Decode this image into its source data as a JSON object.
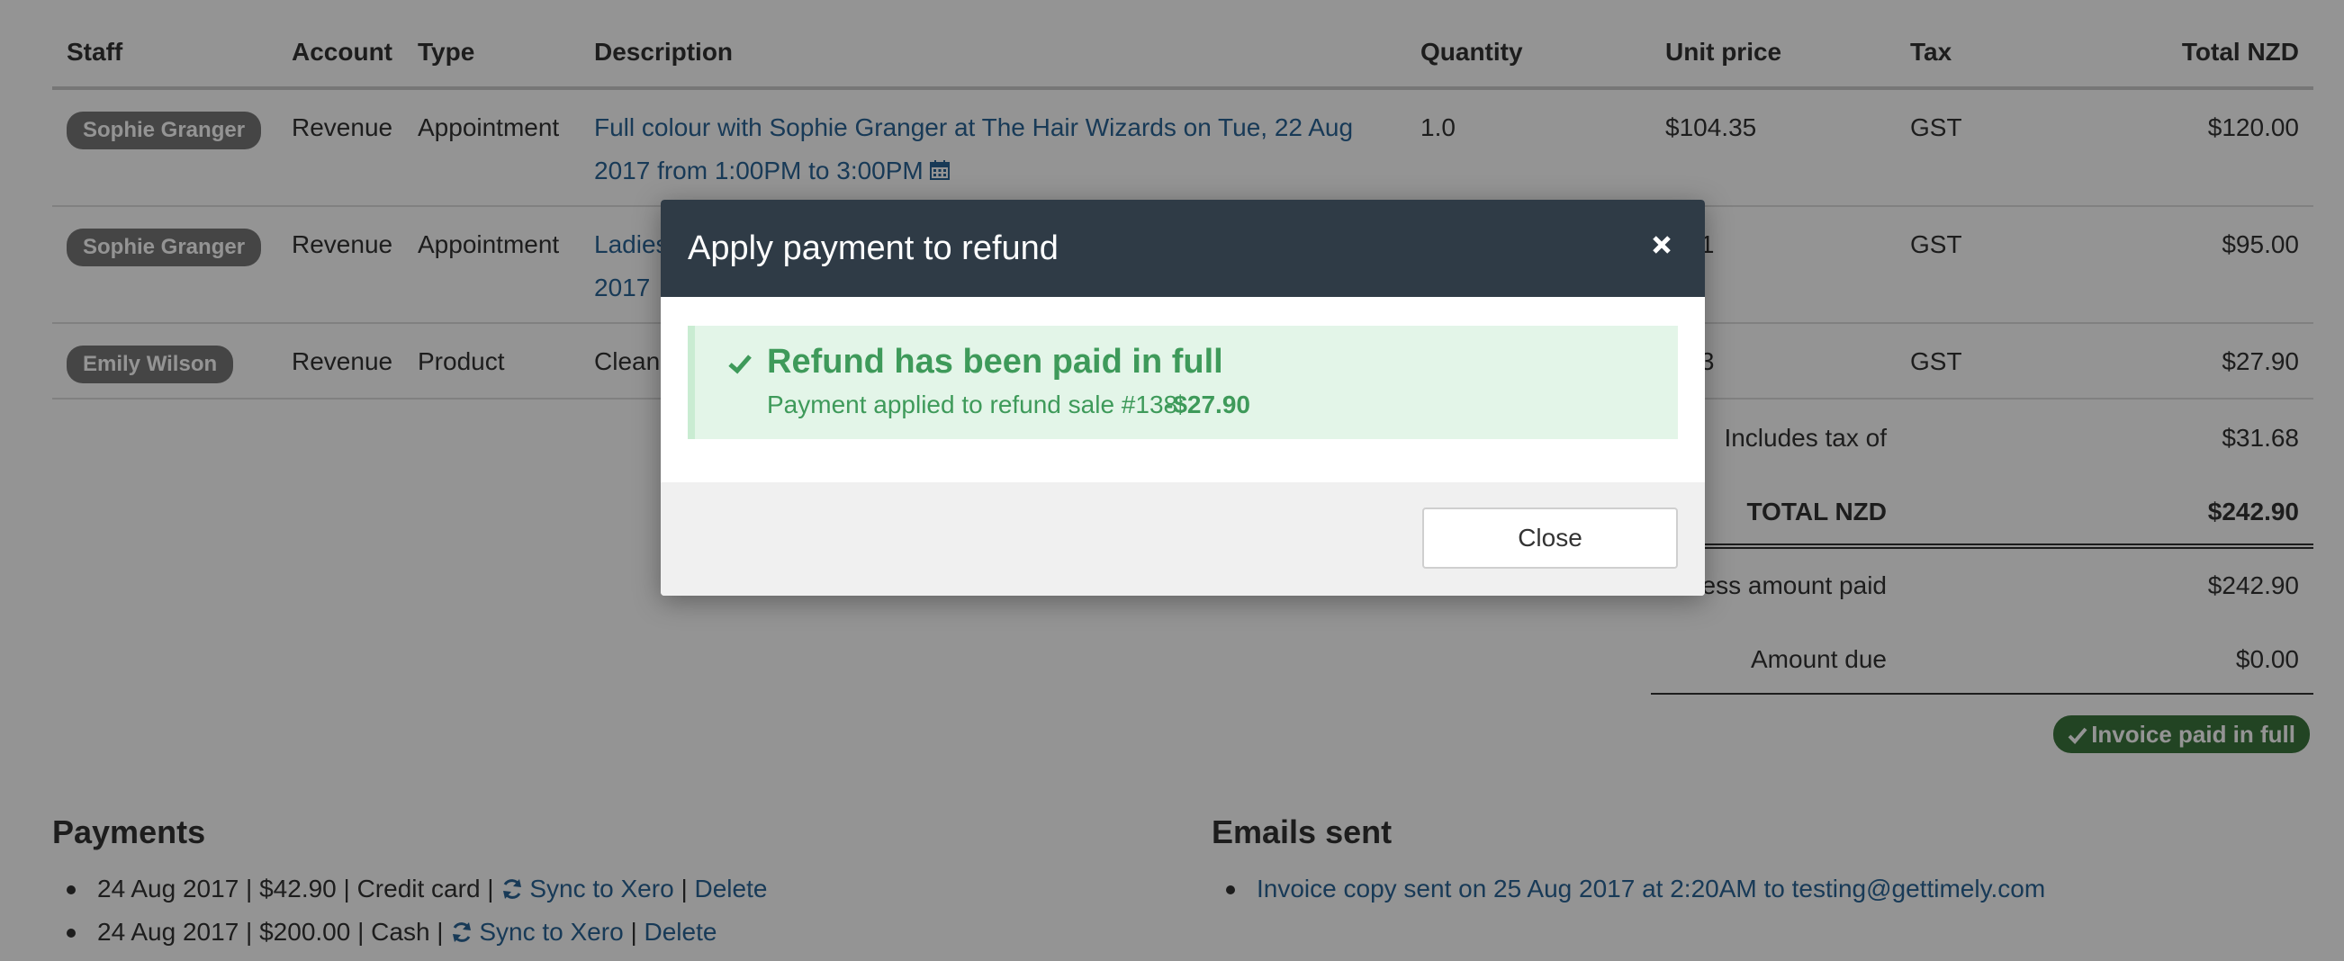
{
  "table": {
    "headers": {
      "staff": "Staff",
      "account": "Account",
      "type": "Type",
      "description": "Description",
      "quantity": "Quantity",
      "unit_price": "Unit price",
      "tax": "Tax",
      "total": "Total NZD"
    },
    "rows": [
      {
        "staff": "Sophie Granger",
        "account": "Revenue",
        "type": "Appointment",
        "description": "Full colour with Sophie Granger at The Hair Wizards on Tue, 22 Aug 2017 from 1:00PM to 3:00PM",
        "quantity": "1.0",
        "unit_price": "$104.35",
        "tax": "GST",
        "total": "$120.00"
      },
      {
        "staff": "Sophie Granger",
        "account": "Revenue",
        "type": "Appointment",
        "description": "Ladies",
        "description_line2": "2017",
        "quantity": "",
        "unit_price": "2.61",
        "tax": "GST",
        "total": "$95.00"
      },
      {
        "staff": "Emily Wilson",
        "account": "Revenue",
        "type": "Product",
        "description": "Cleans",
        "quantity": "",
        "unit_price": "2.13",
        "tax": "GST",
        "total": "$27.90"
      }
    ]
  },
  "totals": {
    "includes_tax_label": "Includes tax of",
    "includes_tax_value": "$31.68",
    "total_label": "TOTAL NZD",
    "total_value": "$242.90",
    "less_paid_label": "ess amount paid",
    "less_paid_value": "$242.90",
    "amount_due_label": "Amount due",
    "amount_due_value": "$0.00",
    "paid_badge": "Invoice paid in full"
  },
  "payments": {
    "title": "Payments",
    "items": [
      {
        "text": "24 Aug 2017 | $42.90 | Credit card |",
        "sync": "Sync to Xero",
        "delete": "Delete"
      },
      {
        "text": "24 Aug 2017 | $200.00 | Cash |",
        "sync": "Sync to Xero",
        "delete": "Delete"
      }
    ]
  },
  "emails": {
    "title": "Emails sent",
    "items": [
      {
        "text": "Invoice copy sent on 25 Aug 2017 at 2:20AM to testing@gettimely.com"
      }
    ]
  },
  "modal": {
    "title": "Apply payment to refund",
    "alert_title": "Refund has been paid in full",
    "alert_text": "Payment applied to refund sale #138:",
    "alert_amount": "-$27.90",
    "close_button": "Close"
  },
  "colors": {
    "link": "#2a6496",
    "modal_header": "#2f3b46",
    "success_text": "#3e9a5a",
    "success_bg": "#e3f5e8",
    "paid_badge": "#3c763d",
    "staff_badge": "#777777"
  }
}
